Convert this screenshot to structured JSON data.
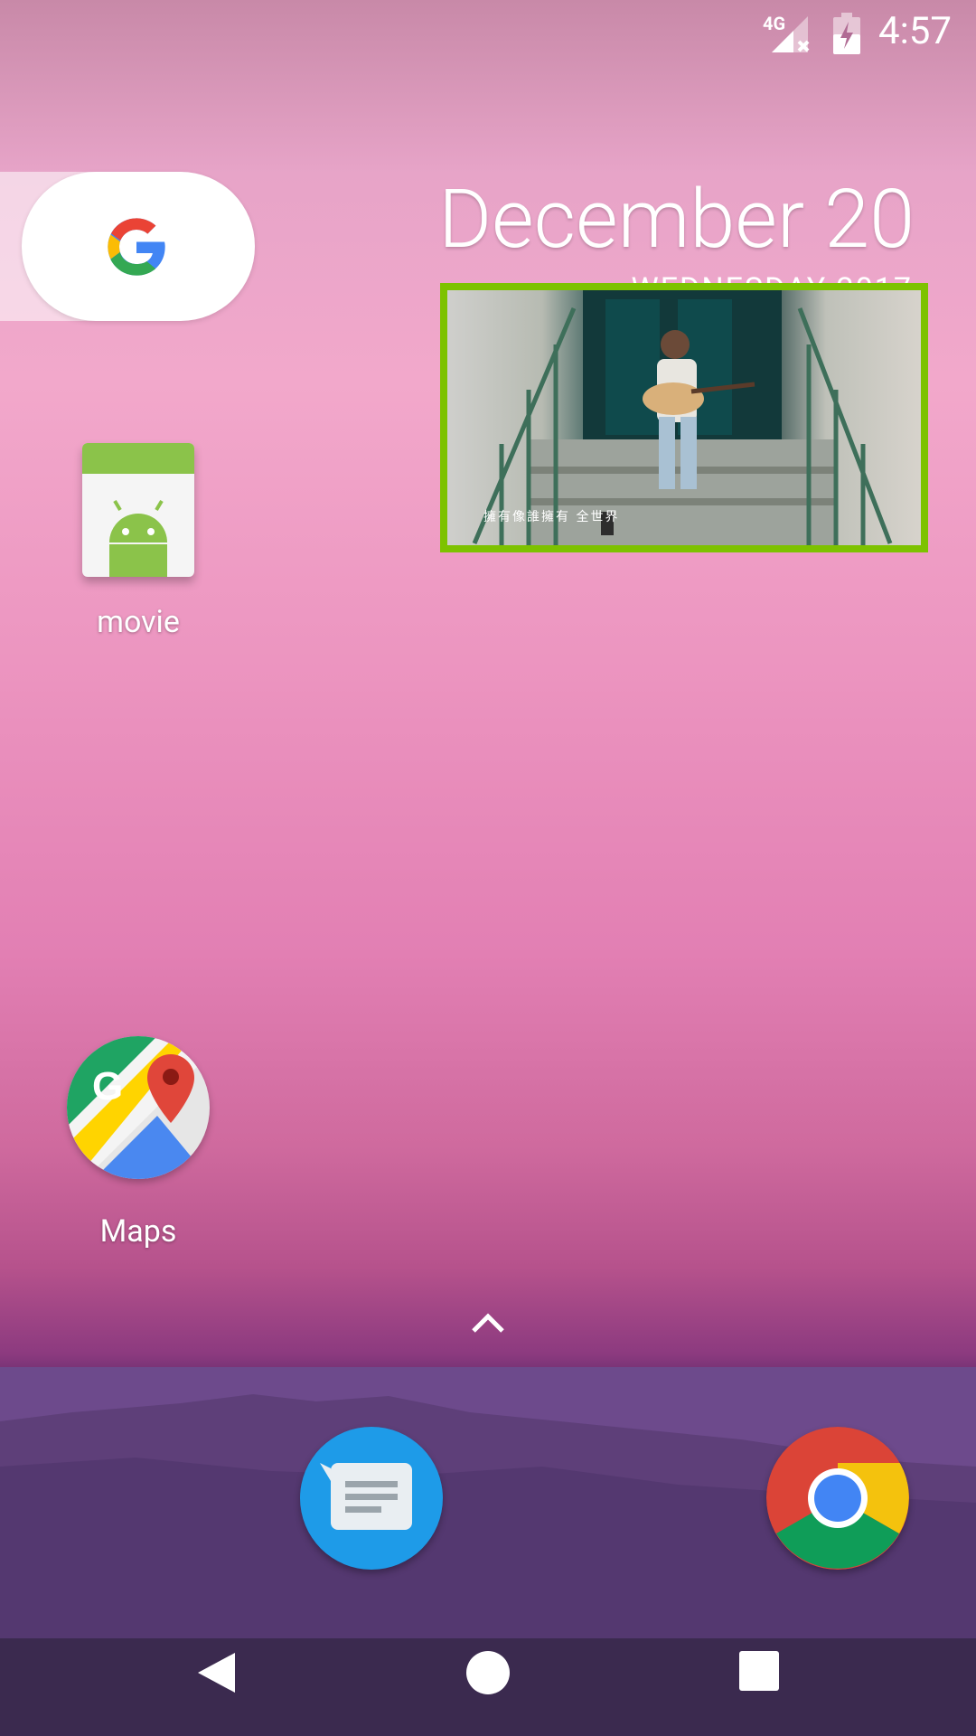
{
  "status_bar": {
    "network": "4G",
    "time": "4:57"
  },
  "widget": {
    "date": "December 20",
    "weekday_year": "WEDNESDAY 2017"
  },
  "apps": {
    "movie": {
      "label": "movie",
      "icon": "android-apk-icon"
    },
    "maps": {
      "label": "Maps",
      "icon": "google-maps-icon"
    }
  },
  "dock": {
    "items": [
      {
        "name": "Messages",
        "icon": "messages-icon"
      },
      {
        "name": "Chrome",
        "icon": "chrome-icon"
      }
    ]
  },
  "video_overlay": {
    "subtitle": "擁有像誰擁有 全世界"
  },
  "colors": {
    "highlight_border": "#7dc200",
    "messages_blue": "#1e9be8"
  }
}
